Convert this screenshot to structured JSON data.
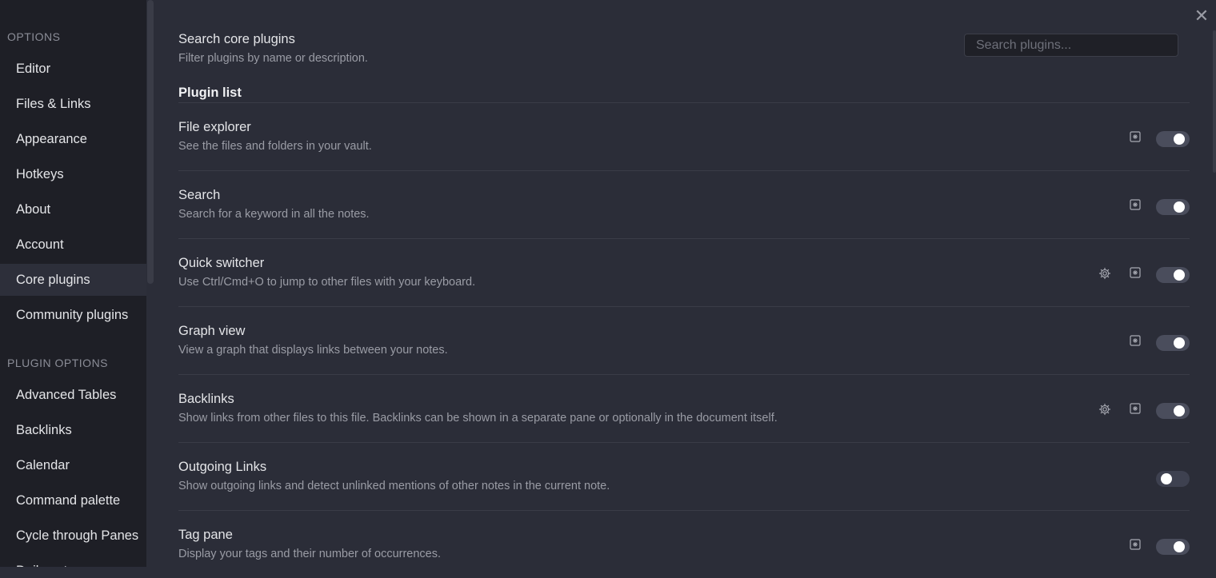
{
  "sidebar": {
    "options_heading": "OPTIONS",
    "options_items": [
      {
        "label": "Editor"
      },
      {
        "label": "Files & Links"
      },
      {
        "label": "Appearance"
      },
      {
        "label": "Hotkeys"
      },
      {
        "label": "About"
      },
      {
        "label": "Account"
      },
      {
        "label": "Core plugins",
        "active": true
      },
      {
        "label": "Community plugins"
      }
    ],
    "plugin_options_heading": "PLUGIN OPTIONS",
    "plugin_items": [
      {
        "label": "Advanced Tables"
      },
      {
        "label": "Backlinks"
      },
      {
        "label": "Calendar"
      },
      {
        "label": "Command palette"
      },
      {
        "label": "Cycle through Panes"
      },
      {
        "label": "Daily notes"
      }
    ]
  },
  "main": {
    "close_icon": "close-icon",
    "search": {
      "title": "Search core plugins",
      "description": "Filter plugins by name or description.",
      "placeholder": "Search plugins..."
    },
    "list_heading": "Plugin list",
    "plugins": [
      {
        "name": "File explorer",
        "description": "See the files and folders in your vault.",
        "settings": false,
        "command": true,
        "enabled": true
      },
      {
        "name": "Search",
        "description": "Search for a keyword in all the notes.",
        "settings": false,
        "command": true,
        "enabled": true
      },
      {
        "name": "Quick switcher",
        "description": "Use Ctrl/Cmd+O to jump to other files with your keyboard.",
        "settings": true,
        "command": true,
        "enabled": true
      },
      {
        "name": "Graph view",
        "description": "View a graph that displays links between your notes.",
        "settings": false,
        "command": true,
        "enabled": true
      },
      {
        "name": "Backlinks",
        "description": "Show links from other files to this file. Backlinks can be shown in a separate pane or optionally in the document itself.",
        "settings": true,
        "command": true,
        "enabled": true
      },
      {
        "name": "Outgoing Links",
        "description": "Show outgoing links and detect unlinked mentions of other notes in the current note.",
        "settings": false,
        "command": false,
        "enabled": false
      },
      {
        "name": "Tag pane",
        "description": "Display your tags and their number of occurrences.",
        "settings": false,
        "command": true,
        "enabled": true
      }
    ]
  }
}
